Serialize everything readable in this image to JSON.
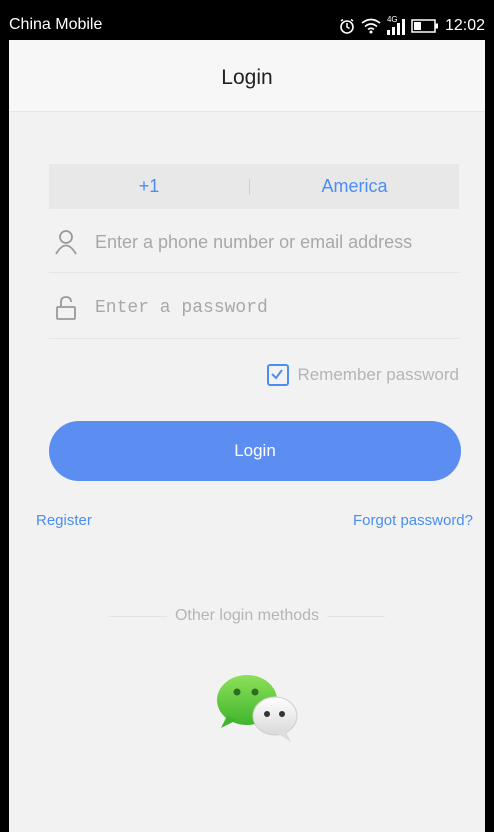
{
  "status_bar": {
    "carrier": "China Mobile",
    "network": "4G",
    "time": "12:02",
    "icons": [
      "alarm-icon",
      "wifi-icon",
      "signal-icon",
      "battery-icon"
    ]
  },
  "header": {
    "title": "Login"
  },
  "form": {
    "country_code": "+1",
    "country_name": "America",
    "username_placeholder": "Enter a phone number or email address",
    "password_placeholder": "Enter a password",
    "remember_label": "Remember password",
    "remember_checked": true,
    "login_label": "Login"
  },
  "links": {
    "register": "Register",
    "forgot": "Forgot password?"
  },
  "other_login": {
    "label": "Other login methods",
    "methods": [
      "wechat-icon"
    ]
  },
  "colors": {
    "accent": "#4b8ef0",
    "button": "#5b8ef0",
    "background": "#f2f2f2",
    "wechat_green": "#5fc93a"
  }
}
